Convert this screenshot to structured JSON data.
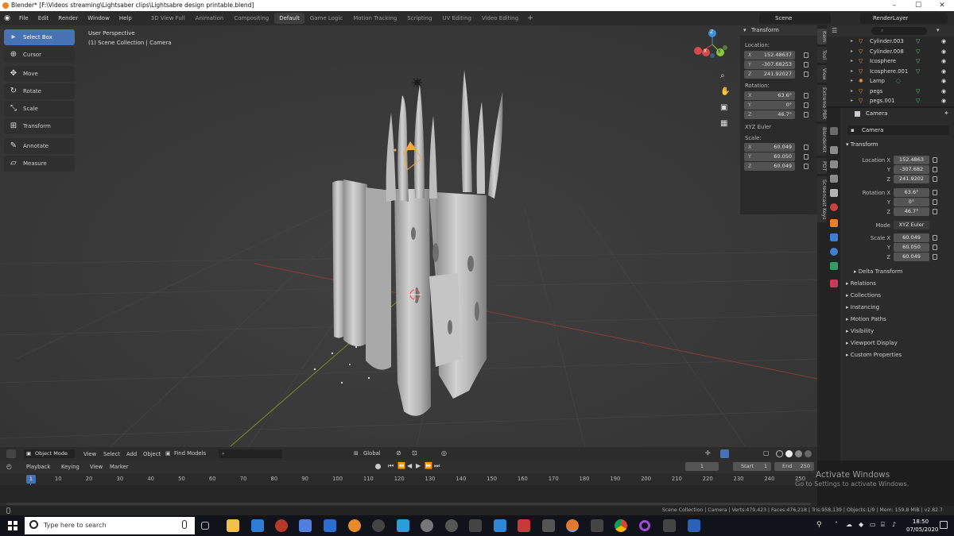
{
  "window": {
    "title": "Blender* [F:\\Videos streaming\\Lightsaber clips\\Lightsabre design printable.blend]",
    "controls": [
      "–",
      "☐",
      "✕"
    ]
  },
  "menus": [
    "File",
    "Edit",
    "Render",
    "Window",
    "Help"
  ],
  "workspaces": [
    {
      "label": "3D View Full",
      "active": false
    },
    {
      "label": "Animation",
      "active": false
    },
    {
      "label": "Compositing",
      "active": false
    },
    {
      "label": "Default",
      "active": true
    },
    {
      "label": "Game Logic",
      "active": false
    },
    {
      "label": "Motion Tracking",
      "active": false
    },
    {
      "label": "Scripting",
      "active": false
    },
    {
      "label": "UV Editing",
      "active": false
    },
    {
      "label": "Video Editing",
      "active": false
    }
  ],
  "scene_name": "Scene",
  "view_layer": "RenderLayer",
  "viewport": {
    "perspective": "User Perspective",
    "collection": "(1) Scene Collection | Camera"
  },
  "tools": [
    {
      "label": "Select Box",
      "icon": "select-box-icon",
      "active": true
    },
    {
      "label": "Cursor",
      "icon": "cursor-icon",
      "active": false
    },
    {
      "label": "Move",
      "icon": "move-icon",
      "active": false
    },
    {
      "label": "Rotate",
      "icon": "rotate-icon",
      "active": false
    },
    {
      "label": "Scale",
      "icon": "scale-icon",
      "active": false
    },
    {
      "label": "Transform",
      "icon": "transform-icon",
      "active": false
    },
    {
      "label": "Annotate",
      "icon": "annotate-icon",
      "active": false
    },
    {
      "label": "Measure",
      "icon": "measure-icon",
      "active": false
    }
  ],
  "gizmo": {
    "x": "X",
    "y": "Y",
    "z": "Z"
  },
  "npanel": {
    "header": "Transform",
    "location_label": "Location:",
    "location": [
      {
        "axis": "X",
        "value": "152.48637"
      },
      {
        "axis": "Y",
        "value": "-307.68253"
      },
      {
        "axis": "Z",
        "value": "241.92027"
      }
    ],
    "rotation_label": "Rotation:",
    "rotation": [
      {
        "axis": "X",
        "value": "63.6°"
      },
      {
        "axis": "Y",
        "value": "0°"
      },
      {
        "axis": "Z",
        "value": "46.7°"
      }
    ],
    "rotation_mode": "XYZ Euler",
    "scale_label": "Scale:",
    "scale": [
      {
        "axis": "X",
        "value": "60.049"
      },
      {
        "axis": "Y",
        "value": "60.050"
      },
      {
        "axis": "Z",
        "value": "60.049"
      }
    ]
  },
  "side_tabs": [
    "Item",
    "Tool",
    "View",
    "Extreme PBR",
    "BlenderKit",
    "PDT",
    "Screencast Keys"
  ],
  "outliner": {
    "search_placeholder": "",
    "items": [
      "Cylinder.003",
      "Cylinder.008",
      "Icosphere",
      "Icosphere.001",
      "Lamp",
      "pegs",
      "pegs.001"
    ]
  },
  "properties": {
    "object_name": "Camera",
    "data_name": "Camera",
    "transform_header": "Transform",
    "location_labels": [
      "Location X",
      "Y",
      "Z"
    ],
    "location": [
      "152.4863",
      "-307.682",
      "241.9202"
    ],
    "rotation_labels": [
      "Rotation X",
      "Y",
      "Z"
    ],
    "rotation": [
      "63.6°",
      "0°",
      "46.7°"
    ],
    "mode_label": "Mode",
    "mode": "XYZ Euler",
    "scale_labels": [
      "Scale X",
      "Y",
      "Z"
    ],
    "scale": [
      "60.049",
      "60.050",
      "60.049"
    ],
    "delta_transform": "Delta Transform",
    "sections": [
      "Relations",
      "Collections",
      "Instancing",
      "Motion Paths",
      "Visibility",
      "Viewport Display",
      "Custom Properties"
    ]
  },
  "viewport_header": {
    "mode": "Object Mode",
    "menus": [
      "View",
      "Select",
      "Add",
      "Object"
    ],
    "addon": "Find Models",
    "orientation": "Global"
  },
  "timeline": {
    "menus": [
      "Playback",
      "Keying",
      "View",
      "Marker"
    ],
    "current_frame": "1",
    "start_label": "Start",
    "start": "1",
    "end_label": "End",
    "end": "250",
    "ticks": [
      "1",
      "10",
      "20",
      "30",
      "40",
      "50",
      "60",
      "70",
      "80",
      "90",
      "100",
      "110",
      "120",
      "130",
      "140",
      "150",
      "160",
      "170",
      "180",
      "190",
      "200",
      "210",
      "220",
      "230",
      "240",
      "250"
    ]
  },
  "status": "Scene Collection | Camera | Verts:479,423 | Faces:476,218 | Tris:958,139 | Objects:1/9 | Mem: 159.8 MiB | v2.82.7",
  "activation": {
    "line1": "Activate Windows",
    "line2": "Go to Settings to activate Windows."
  },
  "taskbar": {
    "search_placeholder": "Type here to search",
    "time": "18:50",
    "date": "07/05/2020"
  },
  "colors": {
    "accent": "#4772b3",
    "axis_x": "#d84a4a",
    "axis_y": "#8cc63f",
    "axis_z": "#3e8fd9",
    "camera": "#f2a93b"
  }
}
